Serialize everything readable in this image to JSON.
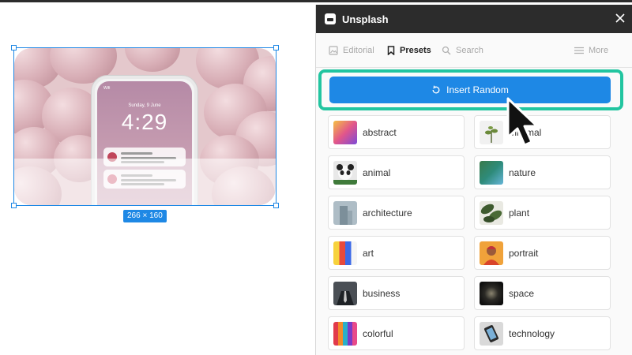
{
  "canvas": {
    "dimensions_label": "266 × 160",
    "phone": {
      "date": "Sunday, 9 June",
      "time": "4:29",
      "status": "Wifi"
    }
  },
  "panel": {
    "title": "Unsplash",
    "close_icon": "close-icon",
    "tabs": [
      {
        "label": "Editorial",
        "icon": "image-icon",
        "active": false
      },
      {
        "label": "Presets",
        "icon": "bookmark-icon",
        "active": true
      },
      {
        "label": "Search",
        "icon": "search-icon",
        "active": false
      },
      {
        "label": "More",
        "icon": "menu-icon",
        "active": false
      }
    ],
    "insert_random_label": "Insert Random",
    "insert_random_icon": "refresh-icon",
    "presets": [
      {
        "label": "abstract",
        "color": "#e2568a"
      },
      {
        "label": "minimal",
        "color": "#eeeeee"
      },
      {
        "label": "animal",
        "color": "#3a3a3a"
      },
      {
        "label": "nature",
        "color": "#2e8b7a"
      },
      {
        "label": "architecture",
        "color": "#8aa0ad"
      },
      {
        "label": "plant",
        "color": "#4a5a3a"
      },
      {
        "label": "art",
        "color": "#f0c040"
      },
      {
        "label": "portrait",
        "color": "#e07a30"
      },
      {
        "label": "business",
        "color": "#333b44"
      },
      {
        "label": "space",
        "color": "#1a1a1a"
      },
      {
        "label": "colorful",
        "color": "#d03050"
      },
      {
        "label": "technology",
        "color": "#c9c9c9"
      }
    ]
  },
  "colors": {
    "accent": "#1e88e5",
    "highlight": "#22c5a0",
    "header": "#2c2c2c"
  }
}
